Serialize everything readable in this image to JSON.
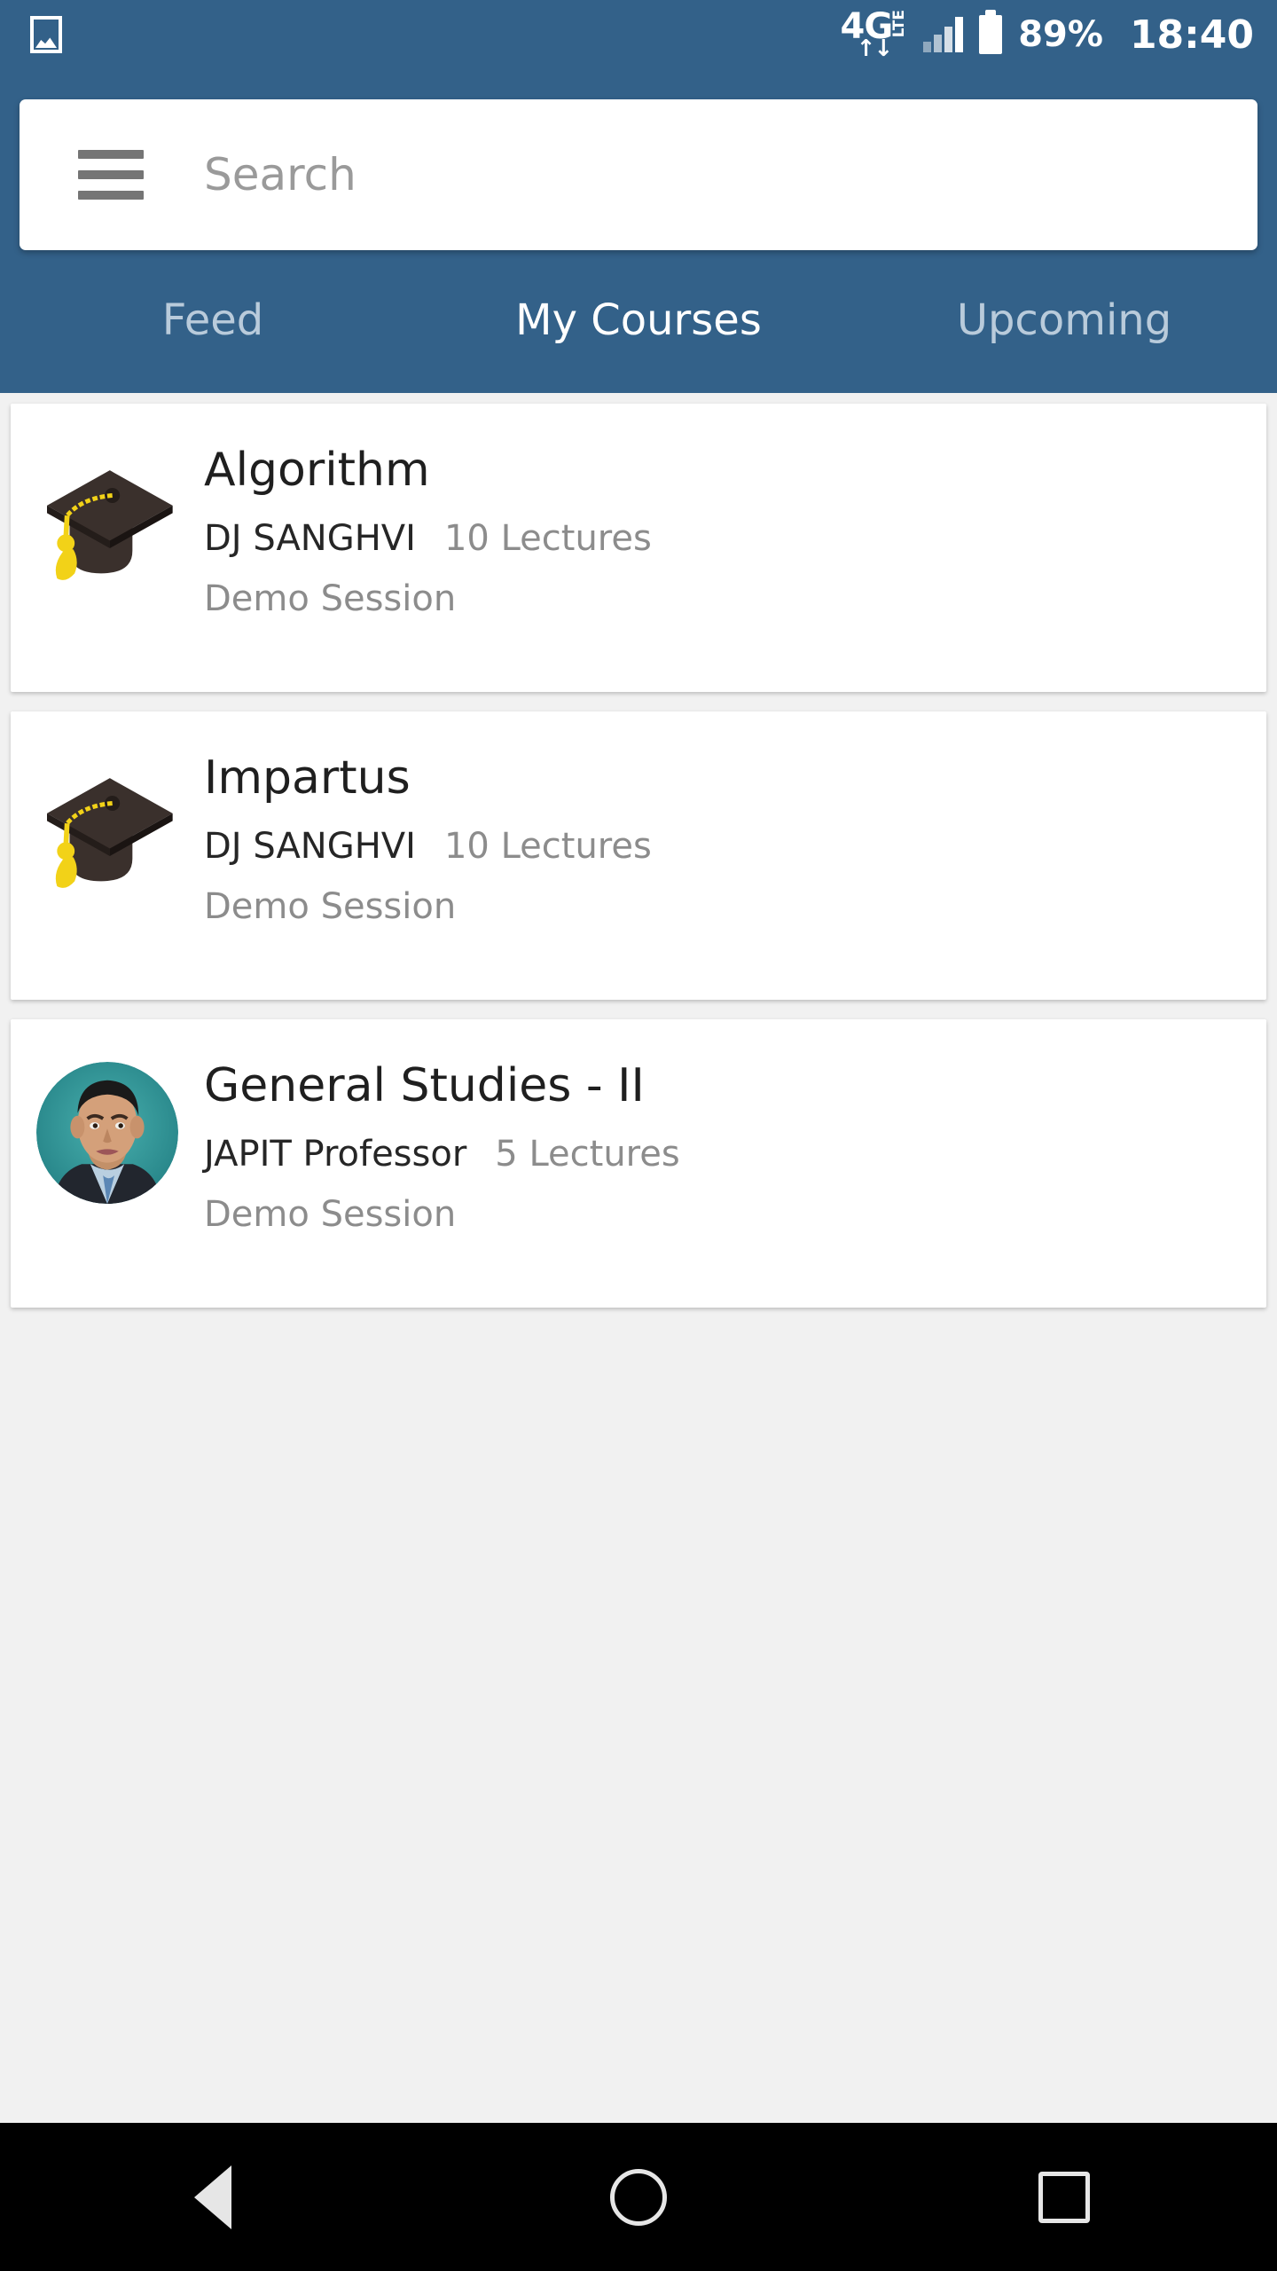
{
  "statusbar": {
    "photo_icon": "photo-icon",
    "network_label": "4G",
    "network_type": "LTE",
    "data_arrows": "↑↓",
    "signal_icon": "signal-bars-icon",
    "battery_icon": "battery-icon",
    "battery_percent": "89%",
    "time": "18:40"
  },
  "search": {
    "menu_icon": "hamburger-menu-icon",
    "placeholder": "Search",
    "value": ""
  },
  "tabs": [
    {
      "label": "Feed",
      "active": false
    },
    {
      "label": "My Courses",
      "active": true
    },
    {
      "label": "Upcoming",
      "active": false
    }
  ],
  "courses": [
    {
      "title": "Algorithm",
      "instructor": "DJ SANGHVI",
      "lectures": "10 Lectures",
      "session": "Demo Session",
      "media": "graduation-cap-icon"
    },
    {
      "title": "Impartus",
      "instructor": "DJ SANGHVI",
      "lectures": "10 Lectures",
      "session": "Demo Session",
      "media": "graduation-cap-icon"
    },
    {
      "title": "General Studies - II",
      "instructor": "JAPIT Professor",
      "lectures": "5 Lectures",
      "session": "Demo Session",
      "media": "professor-avatar"
    }
  ],
  "navbar": {
    "back": "back-icon",
    "home": "home-icon",
    "recents": "recents-icon"
  },
  "colors": {
    "header_blue": "#336189",
    "page_bg": "#f1f1f1",
    "card_bg": "#ffffff",
    "tab_active": "#ffffff",
    "tab_inactive": "#b9cbdb",
    "muted_text": "#8c8c8c",
    "cap_dark": "#3a302c",
    "cap_tassel": "#f2d218",
    "avatar_bg": "#2f9a9a"
  }
}
